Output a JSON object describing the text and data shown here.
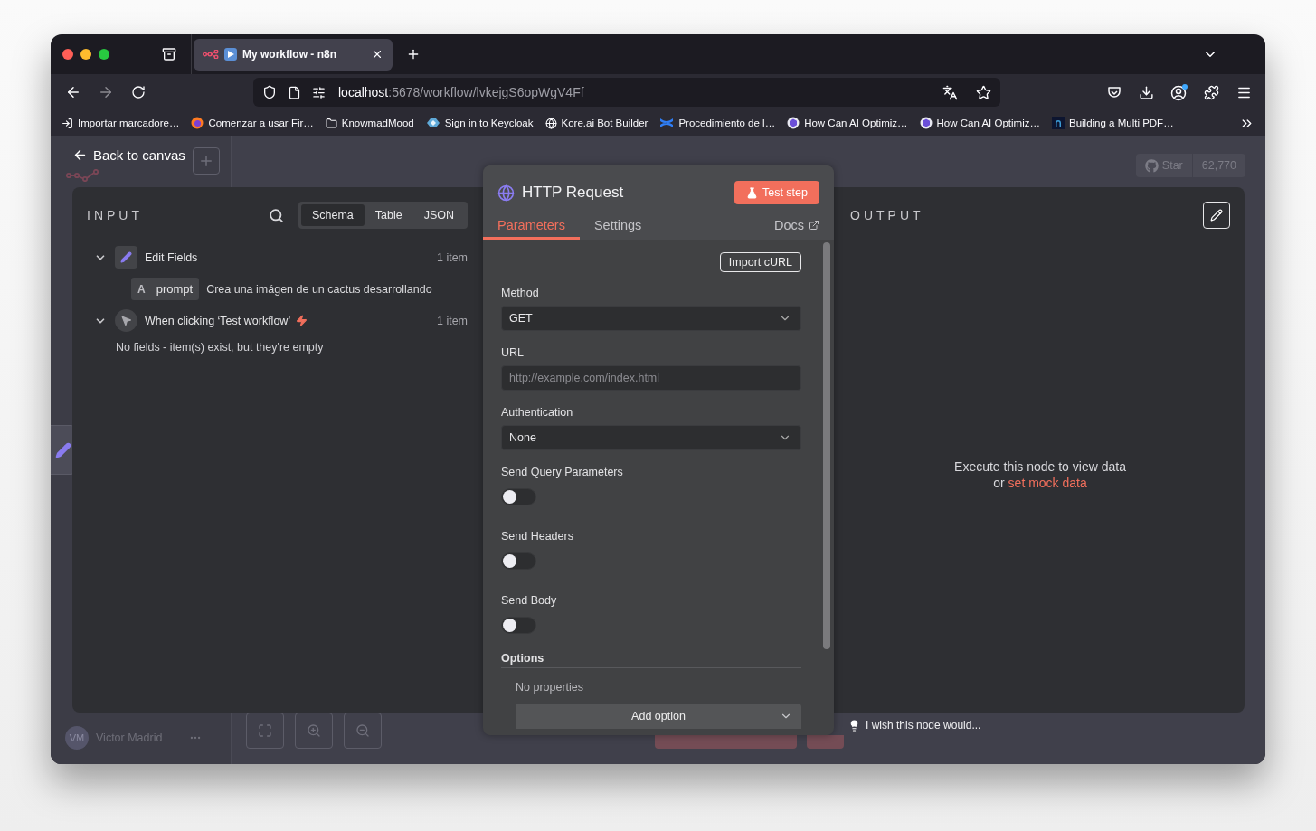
{
  "browser": {
    "tabs": [
      {
        "title": "My workflow - n8n",
        "selected": true
      }
    ],
    "url": {
      "host": "localhost",
      "path": ":5678/workflow/lvkejgS6opWgV4Ff"
    },
    "bookmarks": [
      "Importar marcadore…",
      "Comenzar a usar Fir…",
      "KnowmadMood",
      "Sign in to Keycloak",
      "Kore.ai Bot Builder",
      "Procedimiento de l…",
      "How Can AI Optimiz…",
      "How Can AI Optimiz…",
      "Building a Multi PDF…"
    ]
  },
  "app": {
    "github": {
      "label": "Star",
      "count": "62,770"
    },
    "user": {
      "initials": "VM",
      "name": "Victor Madrid"
    }
  },
  "ndv": {
    "back_label": "Back to canvas",
    "input": {
      "title": "INPUT",
      "views": [
        {
          "label": "Schema",
          "selected": true
        },
        {
          "label": "Table",
          "selected": false
        },
        {
          "label": "JSON",
          "selected": false
        }
      ],
      "nodes": [
        {
          "kind": "edit",
          "name": "Edit Fields",
          "count": "1 item",
          "expanded": true,
          "fields": [
            {
              "type": "A",
              "name": "prompt",
              "value": "Crea una imágen de un cactus desarrollando"
            }
          ]
        },
        {
          "kind": "trigger",
          "name": "When clicking ‘Test workflow’",
          "count": "1 item",
          "expanded": true,
          "empty": "No fields - item(s) exist, but they're empty"
        }
      ]
    },
    "node": {
      "title": "HTTP Request",
      "test_button": "Test step",
      "tabs": [
        {
          "label": "Parameters",
          "selected": true
        },
        {
          "label": "Settings",
          "selected": false
        }
      ],
      "docs": "Docs",
      "import_button": "Import cURL",
      "fields": [
        {
          "kind": "select",
          "label": "Method",
          "value": "GET"
        },
        {
          "kind": "input",
          "label": "URL",
          "placeholder": "http://example.com/index.html"
        },
        {
          "kind": "select",
          "label": "Authentication",
          "value": "None"
        },
        {
          "kind": "toggle",
          "label": "Send Query Parameters",
          "on": false
        },
        {
          "kind": "toggle",
          "label": "Send Headers",
          "on": false
        },
        {
          "kind": "toggle",
          "label": "Send Body",
          "on": false
        }
      ],
      "options": {
        "title": "Options",
        "empty": "No properties",
        "add_button": "Add option"
      }
    },
    "output": {
      "title": "OUTPUT",
      "message": "Execute this node to view data",
      "link_prefix": "or",
      "link": "set mock data"
    },
    "feedback": "I wish this node would..."
  }
}
